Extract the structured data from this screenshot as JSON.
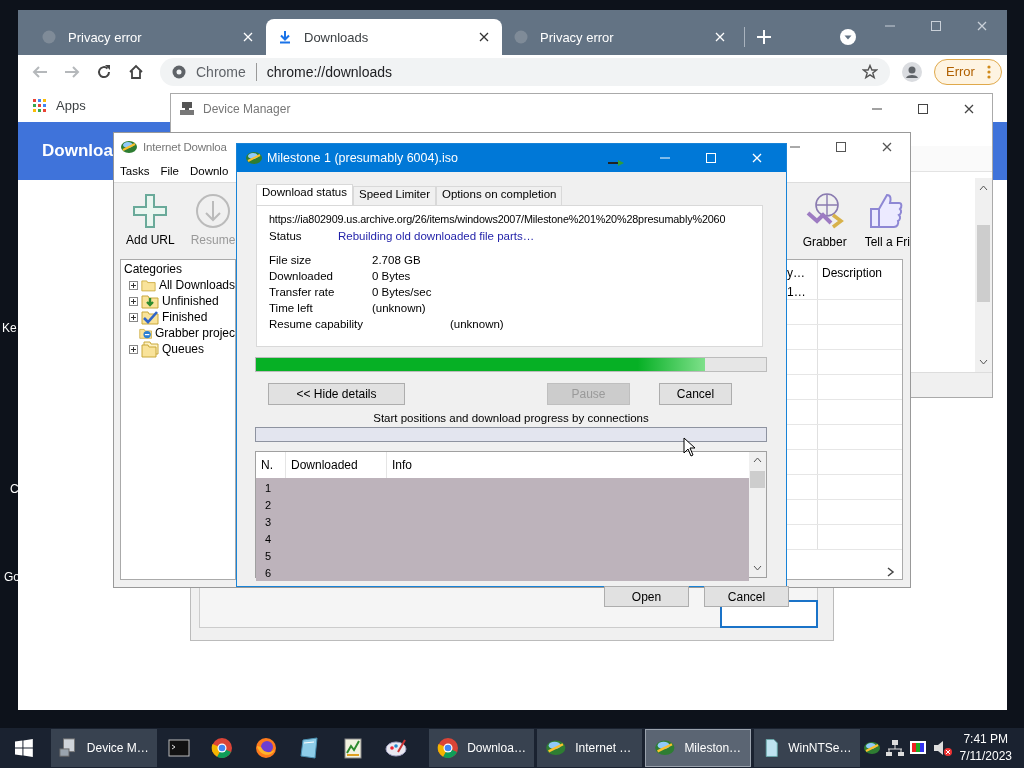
{
  "desktop": {
    "icon_labels": [
      "Ke",
      "C",
      "Go"
    ]
  },
  "browser": {
    "tabs": [
      {
        "title": "Privacy error",
        "selected": false
      },
      {
        "title": "Downloads",
        "selected": true
      },
      {
        "title": "Privacy error",
        "selected": false
      }
    ],
    "omnibox": {
      "chip": "Chrome",
      "url": "chrome://downloads"
    },
    "profile_badge": "Error",
    "bookmarks": [
      "Apps"
    ],
    "page_header": "Downloa"
  },
  "device_manager": {
    "title": "Device Manager"
  },
  "open_dialog": {
    "buttons": [
      "Open",
      "Cancel"
    ]
  },
  "idm": {
    "title": "Internet Downloa",
    "menu": [
      "Tasks",
      "File",
      "Downlo"
    ],
    "toolbar": [
      {
        "label": "Add URL",
        "disabled": false
      },
      {
        "label": "Resume",
        "disabled": true
      }
    ],
    "toolbar_right": [
      "Grabber",
      "Tell a Fri"
    ],
    "categories": {
      "title": "Categories",
      "items": [
        {
          "label": "All Downloads",
          "expandable": true
        },
        {
          "label": "Unfinished",
          "expandable": true
        },
        {
          "label": "Finished",
          "expandable": true
        },
        {
          "label": "Grabber projec",
          "expandable": false
        },
        {
          "label": "Queues",
          "expandable": true
        }
      ]
    },
    "list": {
      "columns": [
        "y…",
        "Description"
      ],
      "rows": [
        "1…"
      ]
    }
  },
  "download_dialog": {
    "title": "Milestone 1 (presumably 6004).iso",
    "tabs": [
      {
        "label": "Download status",
        "selected": true
      },
      {
        "label": "Speed Limiter",
        "selected": false
      },
      {
        "label": "Options on completion",
        "selected": false
      }
    ],
    "url": "https://ia802909.us.archive.org/26/items/windows2007/Milestone%201%20%28presumably%2060",
    "status": {
      "label": "Status",
      "value": "Rebuilding old downloaded file parts…"
    },
    "fields": [
      {
        "label": "File size",
        "value": "2.708  GB"
      },
      {
        "label": "Downloaded",
        "value": "0 Bytes"
      },
      {
        "label": "Transfer rate",
        "value": "0  Bytes/sec"
      },
      {
        "label": "Time left",
        "value": "(unknown)"
      },
      {
        "label": "Resume capability",
        "value": "(unknown)"
      }
    ],
    "progress": {
      "level": 0.88
    },
    "buttons": [
      {
        "label": "<< Hide details",
        "disabled": false
      },
      {
        "label": "Pause",
        "disabled": true
      },
      {
        "label": "Cancel",
        "disabled": false
      }
    ],
    "connections_caption": "Start positions and download progress by connections",
    "connections": {
      "columns": [
        "N.",
        "Downloaded",
        "Info"
      ],
      "rows": [
        "1",
        "2",
        "3",
        "4",
        "5",
        "6"
      ]
    }
  },
  "taskbar": {
    "items": [
      {
        "kind": "window",
        "label": "Device M…",
        "selected": false
      },
      {
        "kind": "pinned"
      },
      {
        "kind": "pinned"
      },
      {
        "kind": "pinned"
      },
      {
        "kind": "pinned"
      },
      {
        "kind": "pinned"
      },
      {
        "kind": "pinned"
      },
      {
        "kind": "window",
        "label": "Downloa…",
        "selected": false
      },
      {
        "kind": "window",
        "label": "Internet …",
        "selected": false
      },
      {
        "kind": "window",
        "label": "Mileston…",
        "selected": true
      },
      {
        "kind": "window",
        "label": "WinNTSe…",
        "selected": false
      }
    ],
    "clock": {
      "time": "7:41 PM",
      "date": "7/11/2023"
    }
  }
}
